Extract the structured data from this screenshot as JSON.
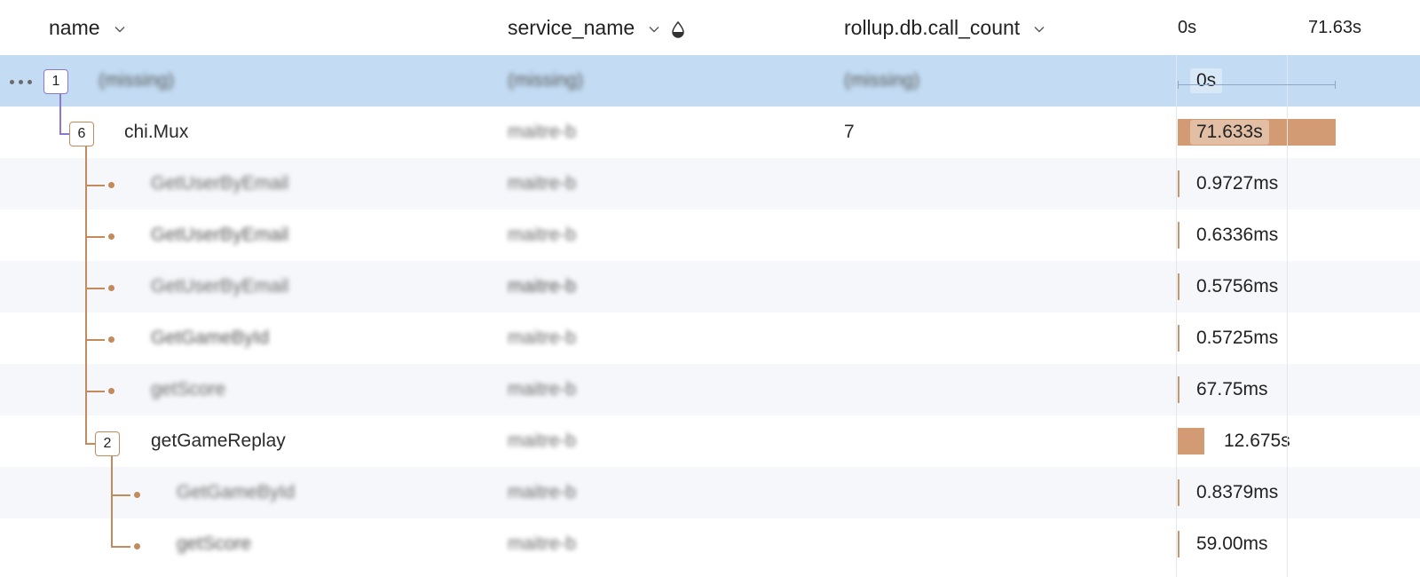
{
  "columns": {
    "name": "name",
    "service_name": "service_name",
    "call_count": "rollup.db.call_count",
    "timeline_start": "0s",
    "timeline_end": "71.63s"
  },
  "colors": {
    "selected_row": "#c3dcf3",
    "span_bar": "#d29b74",
    "tree_line": "#c38a5c",
    "root_badge": "#8b78cf"
  },
  "rows": [
    {
      "badge": "1",
      "name": "(missing)",
      "service": "(missing)",
      "call_count": "(missing)",
      "duration": "0s"
    },
    {
      "badge": "6",
      "name": "chi.Mux",
      "service": "maitre-b",
      "call_count": "7",
      "duration": "71.633s"
    },
    {
      "name": "GetUserByEmail",
      "service": "maitre-b",
      "call_count": "",
      "duration": "0.9727ms"
    },
    {
      "name": "GetUserByEmail",
      "service": "maitre-b",
      "call_count": "",
      "duration": "0.6336ms"
    },
    {
      "name": "GetUserByEmail",
      "service": "maitre-b",
      "call_count": "",
      "duration": "0.5756ms"
    },
    {
      "name": "GetGameById",
      "service": "maitre-b",
      "call_count": "",
      "duration": "0.5725ms"
    },
    {
      "name": "getScore",
      "service": "maitre-b",
      "call_count": "",
      "duration": "67.75ms"
    },
    {
      "badge": "2",
      "name": "getGameReplay",
      "service": "maitre-b",
      "call_count": "",
      "duration": "12.675s"
    },
    {
      "name": "GetGameById",
      "service": "maitre-b",
      "call_count": "",
      "duration": "0.8379ms"
    },
    {
      "name": "getScore",
      "service": "maitre-b",
      "call_count": "",
      "duration": "59.00ms"
    }
  ],
  "icons": {
    "sort": "chevron-down-icon",
    "heatmap": "droplet-icon",
    "more": "more-dots-icon"
  }
}
